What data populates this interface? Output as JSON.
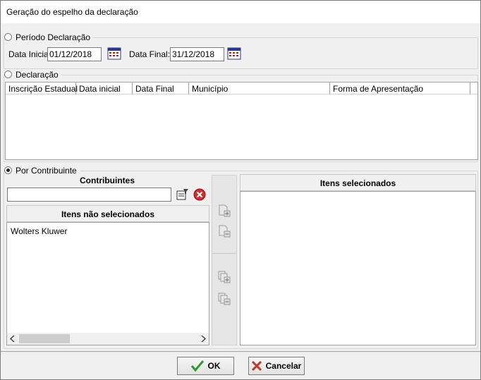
{
  "window": {
    "title": "Geração do espelho da declaração"
  },
  "periodo": {
    "legend": "Período Declaração",
    "data_inicial_label": "Data Inicial",
    "data_inicial_value": "01/12/2018",
    "data_final_label": "Data Final:",
    "data_final_value": "31/12/2018"
  },
  "declaracao": {
    "legend": "Declaração",
    "columns": [
      "Inscrição Estadual",
      "Data inicial",
      "Data Final",
      "Município",
      "Forma de Apresentação"
    ]
  },
  "contribuinte": {
    "legend": "Por Contribuinte",
    "contribuintes_label": "Contribuintes",
    "search_value": "",
    "nao_selecionados_label": "Itens não selecionados",
    "nao_selecionados_items": [
      "Wolters Kluwer"
    ],
    "selecionados_label": "Itens selecionados",
    "selecionados_items": []
  },
  "buttons": {
    "ok": "OK",
    "cancelar": "Cancelar"
  },
  "colors": {
    "accent_check": "#2e9a2e",
    "cancel_x": "#c0392b"
  }
}
